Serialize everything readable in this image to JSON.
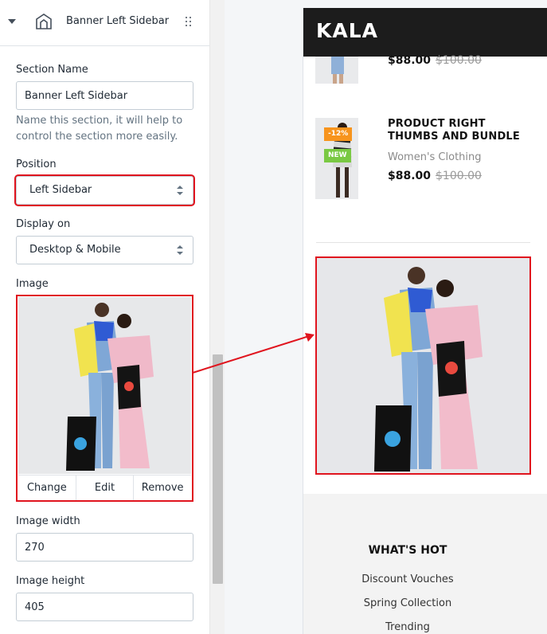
{
  "panel": {
    "section_title": "Banner Left Sidebar",
    "section_name": {
      "label": "Section Name",
      "value": "Banner Left Sidebar",
      "help": "Name this section, it will help to control the section more easily."
    },
    "position": {
      "label": "Position",
      "value": "Left Sidebar"
    },
    "display_on": {
      "label": "Display on",
      "value": "Desktop & Mobile"
    },
    "image": {
      "label": "Image",
      "actions": {
        "change": "Change",
        "edit": "Edit",
        "remove": "Remove"
      }
    },
    "image_width": {
      "label": "Image width",
      "value": "270"
    },
    "image_height": {
      "label": "Image height",
      "value": "405"
    }
  },
  "preview": {
    "logo": "KALA",
    "product_1": {
      "price": "$88.00",
      "old_price": "$100.00"
    },
    "product_2": {
      "title": "PRODUCT RIGHT THUMBS AND BUNDLE",
      "category": "Women's Clothing",
      "price": "$88.00",
      "old_price": "$100.00",
      "badge_sale": "-12%",
      "badge_new": "NEW"
    },
    "footer": {
      "title": "WHAT'S HOT",
      "links": [
        "Discount Vouches",
        "Spring Collection",
        "Trending"
      ]
    }
  },
  "colors": {
    "highlight": "#e0141e",
    "badge_sale": "#f7941d",
    "badge_new": "#7ac943",
    "header_bar": "#1c1c1c"
  }
}
